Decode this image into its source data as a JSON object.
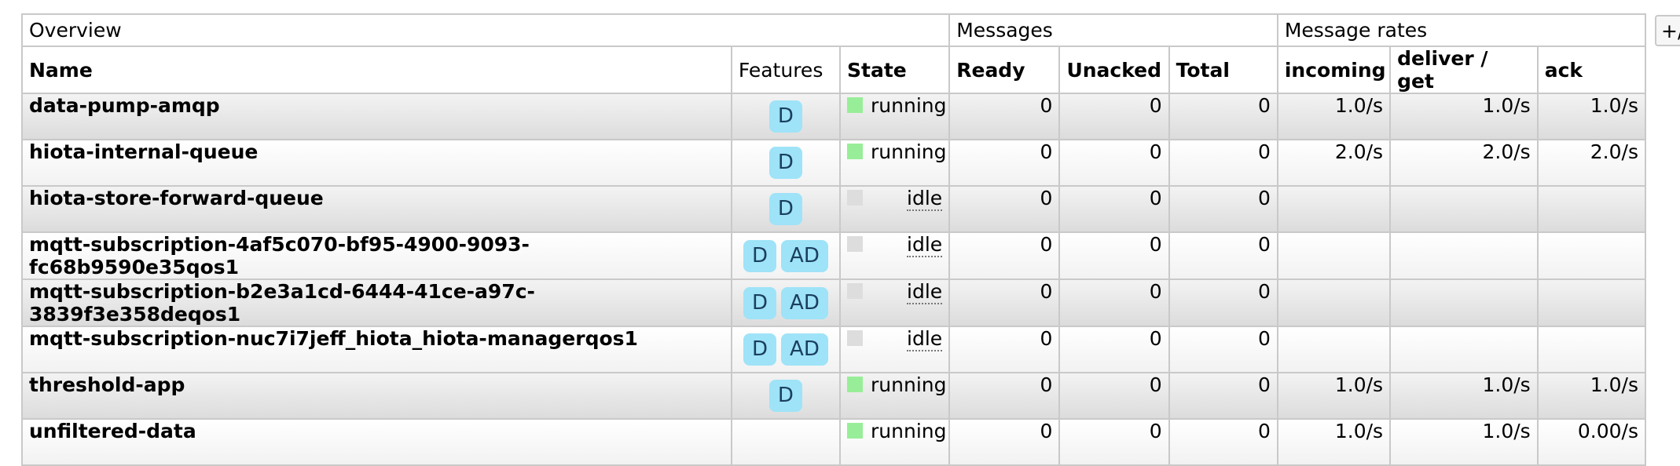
{
  "header": {
    "overview": "Overview",
    "messages": "Messages",
    "message_rates": "Message rates"
  },
  "columns": {
    "name": "Name",
    "features": "Features",
    "state": "State",
    "ready": "Ready",
    "unacked": "Unacked",
    "total": "Total",
    "incoming": "incoming",
    "deliver_get": "deliver / get",
    "ack": "ack"
  },
  "toggle_label": "+/",
  "colors": {
    "running": "#98ee98",
    "idle": "#dddddd",
    "badge": "#9ee3f8"
  },
  "queues": [
    {
      "name": "data-pump-amqp",
      "features": [
        "D"
      ],
      "state": "running",
      "ready": "0",
      "unacked": "0",
      "total": "0",
      "incoming": "1.0/s",
      "deliver_get": "1.0/s",
      "ack": "1.0/s"
    },
    {
      "name": "hiota-internal-queue",
      "features": [
        "D"
      ],
      "state": "running",
      "ready": "0",
      "unacked": "0",
      "total": "0",
      "incoming": "2.0/s",
      "deliver_get": "2.0/s",
      "ack": "2.0/s"
    },
    {
      "name": "hiota-store-forward-queue",
      "features": [
        "D"
      ],
      "state": "idle",
      "ready": "0",
      "unacked": "0",
      "total": "0",
      "incoming": "",
      "deliver_get": "",
      "ack": ""
    },
    {
      "name": "mqtt-subscription-4af5c070-bf95-4900-9093-fc68b9590e35qos1",
      "features": [
        "D",
        "AD"
      ],
      "state": "idle",
      "ready": "0",
      "unacked": "0",
      "total": "0",
      "incoming": "",
      "deliver_get": "",
      "ack": ""
    },
    {
      "name": "mqtt-subscription-b2e3a1cd-6444-41ce-a97c-3839f3e358deqos1",
      "features": [
        "D",
        "AD"
      ],
      "state": "idle",
      "ready": "0",
      "unacked": "0",
      "total": "0",
      "incoming": "",
      "deliver_get": "",
      "ack": ""
    },
    {
      "name": "mqtt-subscription-nuc7i7jeff_hiota_hiota-managerqos1",
      "features": [
        "D",
        "AD"
      ],
      "state": "idle",
      "ready": "0",
      "unacked": "0",
      "total": "0",
      "incoming": "",
      "deliver_get": "",
      "ack": ""
    },
    {
      "name": "threshold-app",
      "features": [
        "D"
      ],
      "state": "running",
      "ready": "0",
      "unacked": "0",
      "total": "0",
      "incoming": "1.0/s",
      "deliver_get": "1.0/s",
      "ack": "1.0/s"
    },
    {
      "name": "unfiltered-data",
      "features": [],
      "state": "running",
      "ready": "0",
      "unacked": "0",
      "total": "0",
      "incoming": "1.0/s",
      "deliver_get": "1.0/s",
      "ack": "0.00/s"
    }
  ]
}
